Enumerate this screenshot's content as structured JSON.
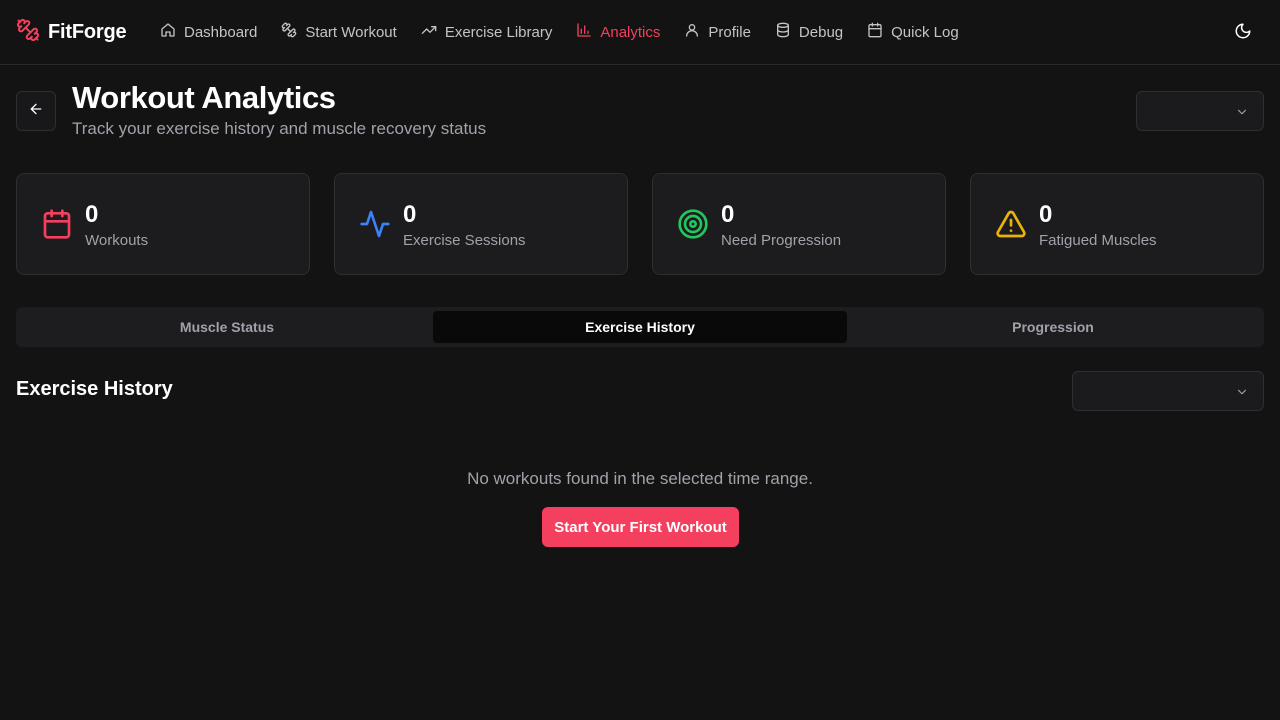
{
  "app": {
    "name": "FitForge",
    "accent": "#f43f5e"
  },
  "nav": {
    "items": [
      {
        "label": "Dashboard",
        "icon": "home-icon",
        "active": false
      },
      {
        "label": "Start Workout",
        "icon": "dumbbell-icon",
        "active": false
      },
      {
        "label": "Exercise Library",
        "icon": "trending-up-icon",
        "active": false
      },
      {
        "label": "Analytics",
        "icon": "bar-chart-icon",
        "active": true
      },
      {
        "label": "Profile",
        "icon": "user-icon",
        "active": false
      },
      {
        "label": "Debug",
        "icon": "database-icon",
        "active": false
      },
      {
        "label": "Quick Log",
        "icon": "calendar-icon",
        "active": false
      }
    ],
    "theme_icon": "moon-icon"
  },
  "header": {
    "title": "Workout Analytics",
    "subtitle": "Track your exercise history and muscle recovery status",
    "range_select_value": ""
  },
  "stats": [
    {
      "value": "0",
      "label": "Workouts",
      "icon": "calendar-icon",
      "color": "#f43f5e"
    },
    {
      "value": "0",
      "label": "Exercise Sessions",
      "icon": "activity-icon",
      "color": "#3b82f6"
    },
    {
      "value": "0",
      "label": "Need Progression",
      "icon": "target-icon",
      "color": "#22c55e"
    },
    {
      "value": "0",
      "label": "Fatigued Muscles",
      "icon": "alert-triangle-icon",
      "color": "#eab308"
    }
  ],
  "tabs": [
    {
      "label": "Muscle Status",
      "active": false
    },
    {
      "label": "Exercise History",
      "active": true
    },
    {
      "label": "Progression",
      "active": false
    }
  ],
  "section": {
    "title": "Exercise History",
    "filter_select_value": "",
    "empty_message": "No workouts found in the selected time range.",
    "cta_label": "Start Your First Workout"
  }
}
